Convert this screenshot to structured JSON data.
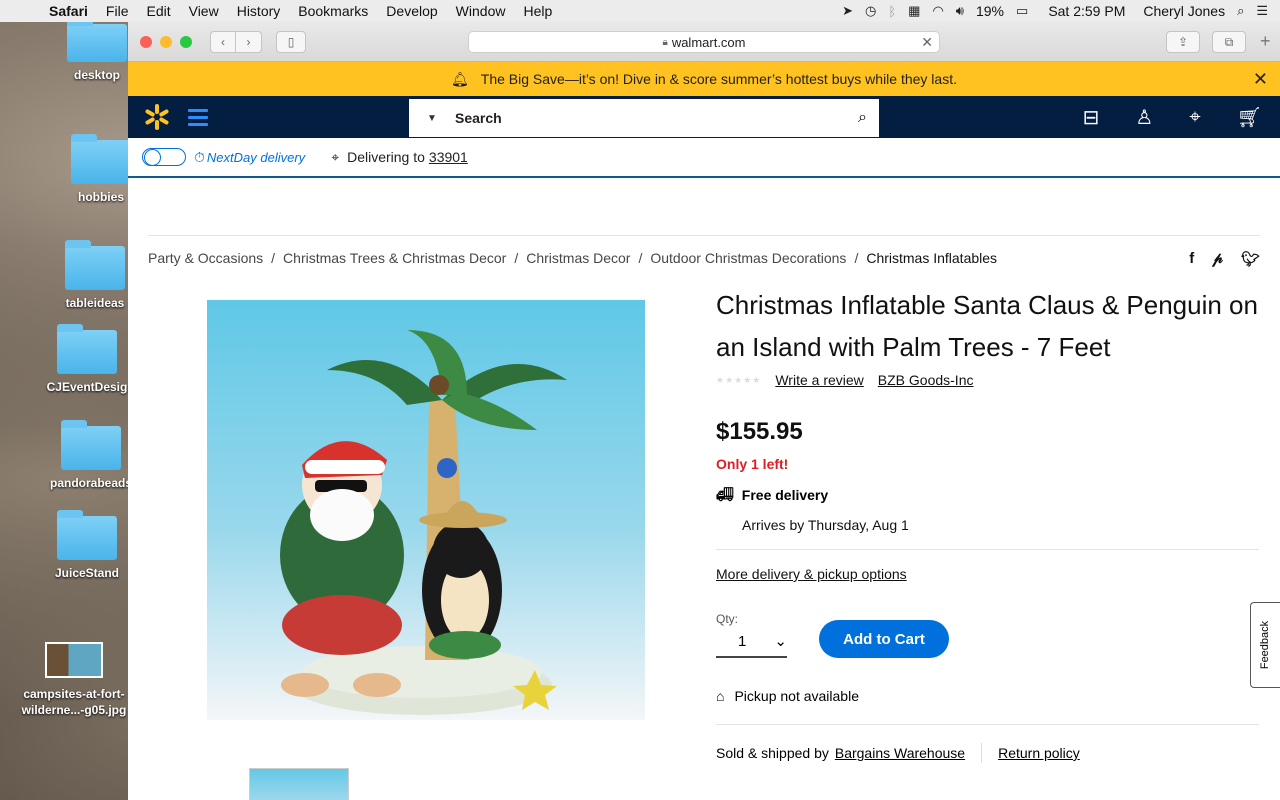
{
  "menubar": {
    "app": "Safari",
    "items": [
      "File",
      "Edit",
      "View",
      "History",
      "Bookmarks",
      "Develop",
      "Window",
      "Help"
    ],
    "battery": "19%",
    "clock": "Sat 2:59 PM",
    "user": "Cheryl Jones"
  },
  "desktop": {
    "icons": [
      {
        "label": "desktop",
        "kind": "folder"
      },
      {
        "label": "hobbies",
        "kind": "folder"
      },
      {
        "label": "tableideas",
        "kind": "folder"
      },
      {
        "label": "CJEventDesig",
        "kind": "folder"
      },
      {
        "label": "pandorabeads",
        "kind": "folder"
      },
      {
        "label": "JuiceStand",
        "kind": "folder"
      },
      {
        "label": "campsites-at-fort-wilderne...-g05.jpg",
        "kind": "image"
      }
    ]
  },
  "browser": {
    "url": "walmart.com"
  },
  "promo": {
    "text": "The Big Save—it’s on! Dive in & score summer’s hottest buys while they last."
  },
  "header": {
    "search_placeholder": "Search",
    "icons": [
      "reorder-icon",
      "account-icon",
      "store-location-icon",
      "cart-icon"
    ],
    "brand_color": "#041e42",
    "accent_color": "#ffc220"
  },
  "subheader": {
    "nextday_label": "NextDay delivery",
    "delivering_label": "Delivering to",
    "zip": "33901"
  },
  "breadcrumbs": [
    "Party & Occasions",
    "Christmas Trees & Christmas Decor",
    "Christmas Decor",
    "Outdoor Christmas Decorations",
    "Christmas Inflatables"
  ],
  "product": {
    "title": "Christmas Inflatable Santa Claus & Penguin on an Island with Palm Trees - 7 Feet",
    "write_review": "Write a review",
    "brand": "BZB Goods-Inc",
    "price": "$155.95",
    "stock": "Only 1 left!",
    "free_delivery": "Free delivery",
    "arrives": "Arrives by Thursday, Aug 1",
    "more_options": "More delivery & pickup options",
    "qty_label": "Qty:",
    "qty_value": "1",
    "add_to_cart": "Add to Cart",
    "pickup": "Pickup not available",
    "sold_by_label": "Sold & shipped by",
    "seller": "Bargains Warehouse",
    "return_policy": "Return policy"
  },
  "feedback_label": "Feedback"
}
